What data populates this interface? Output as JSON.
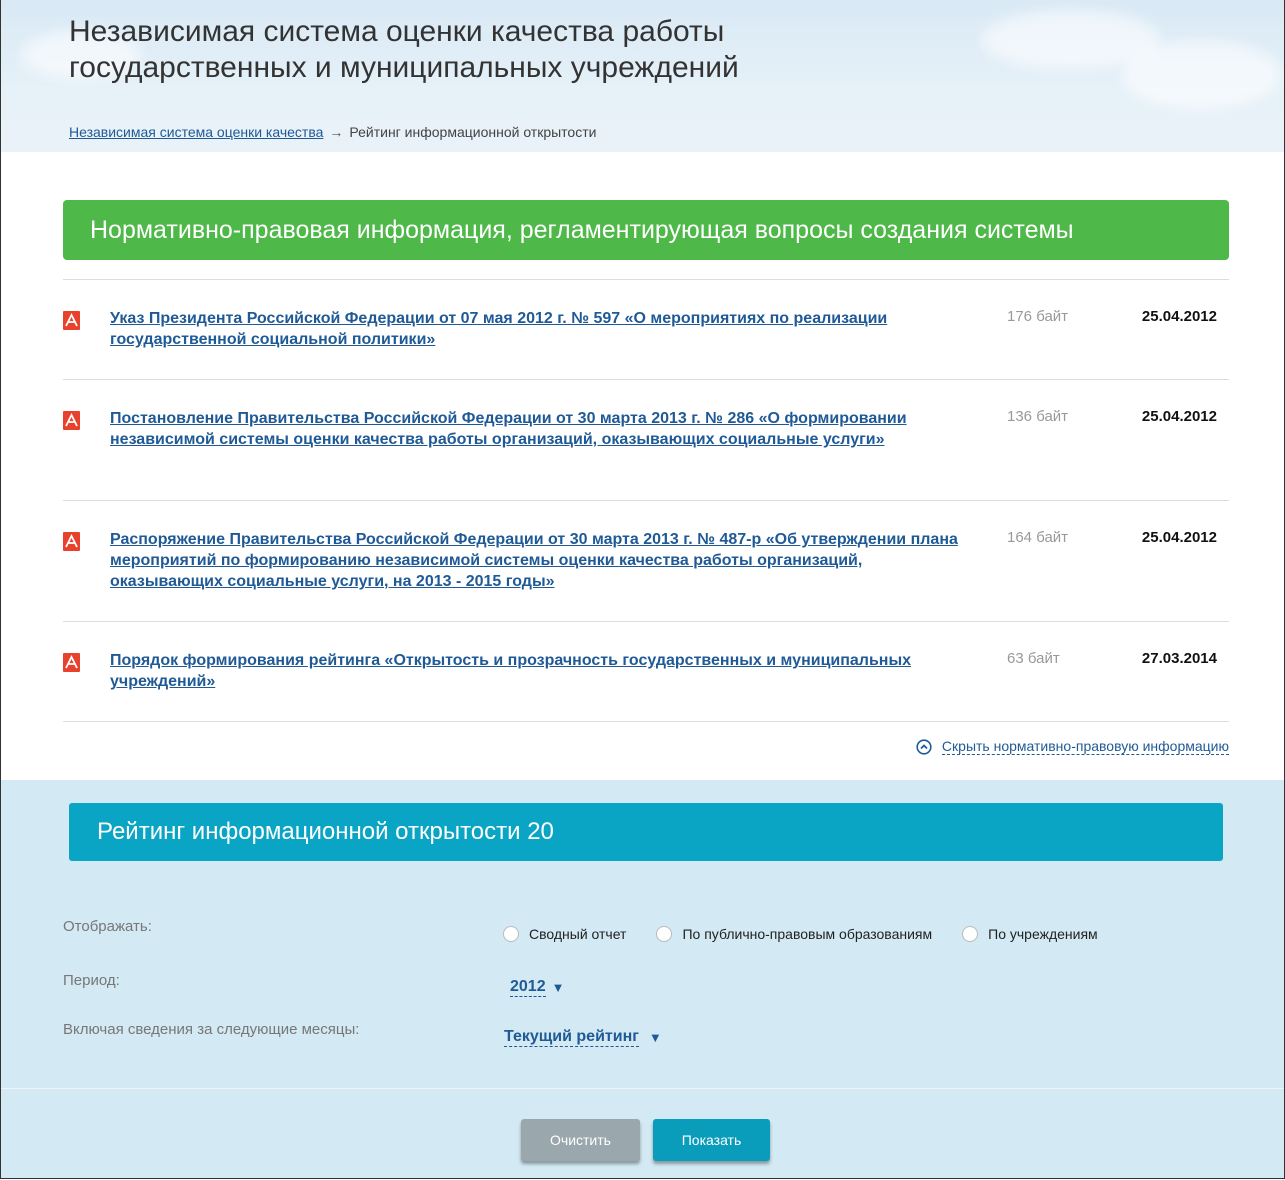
{
  "header": {
    "title_line1": "Независимая система оценки качества работы",
    "title_line2": "государственных и муниципальных учреждений",
    "breadcrumb": {
      "link": "Независимая система оценки качества",
      "separator": "→",
      "current": "Рейтинг информационной открытости"
    }
  },
  "normative": {
    "heading": "Нормативно-правовая информация, регламентирующая вопросы создания системы",
    "documents": [
      {
        "icon": "pdf-icon",
        "title": "Указ Президента Российской Федерации от 07 мая 2012 г. № 597 «О мероприятиях по реализации государственной социальной политики»",
        "size": "176 байт",
        "date": "25.04.2012"
      },
      {
        "icon": "pdf-icon",
        "title": "Постановление Правительства Российской Федерации от 30 марта 2013 г. № 286 «О формировании независимой системы оценки качества работы организаций, оказывающих социальные услуги»",
        "size": "136 байт",
        "date": "25.04.2012"
      },
      {
        "icon": "pdf-icon",
        "title": "Распоряжение Правительства Российской Федерации от 30 марта 2013 г. № 487-р «Об утверждении плана мероприятий по формированию независимой системы оценки качества работы организаций, оказывающих социальные услуги, на 2013 - 2015 годы»",
        "size": "164 байт",
        "date": "25.04.2012"
      },
      {
        "icon": "pdf-icon",
        "title": "Порядок формирования рейтинга «Открытость и прозрачность государственных и муниципальных учреждений»",
        "size": "63 байт",
        "date": "27.03.2014"
      }
    ],
    "hide_link": "Скрыть нормативно-правовую информацию"
  },
  "rating": {
    "heading": "Рейтинг информационной открытости 20",
    "display_label": "Отображать:",
    "display_options": [
      "Сводный отчет",
      "По публично-правовым образованиям",
      "По учреждениям"
    ],
    "period_label": "Период:",
    "period_value": "2012",
    "months_label": "Включая сведения за следующие месяцы:",
    "months_value": "Текущий рейтинг",
    "clear_button": "Очистить",
    "show_button": "Показать"
  },
  "colors": {
    "green_bar": "#4eb849",
    "teal_bar": "#0aa5c5",
    "link": "#1f5a96",
    "rating_bg": "#d3e9f3",
    "pdf_red": "#e8412c"
  }
}
